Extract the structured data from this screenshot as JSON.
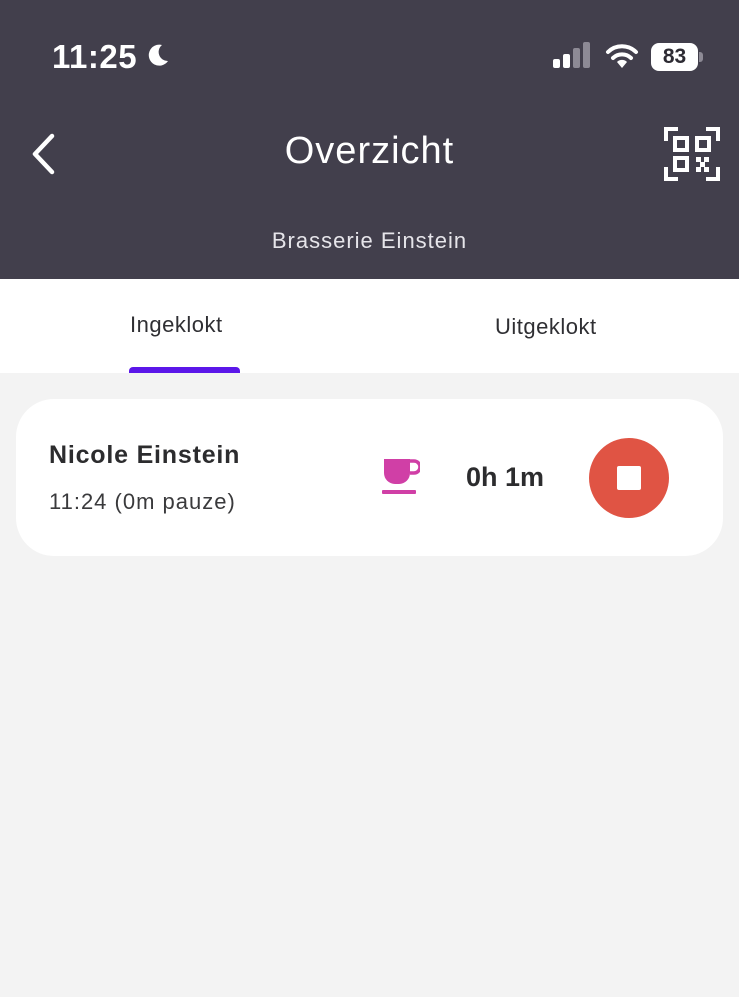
{
  "status_bar": {
    "time": "11:25",
    "battery": "83"
  },
  "header": {
    "title": "Overzicht",
    "subtitle": "Brasserie Einstein"
  },
  "tabs": [
    {
      "label": "Ingeklokt",
      "active": true
    },
    {
      "label": "Uitgeklokt",
      "active": false
    }
  ],
  "entries": [
    {
      "name": "Nicole Einstein",
      "clock_in": "11:24 (0m pauze)",
      "duration": "0h 1m",
      "break_icon": "coffee-cup-icon",
      "action_icon": "stop-icon"
    }
  ],
  "colors": {
    "header_bg": "#423f4c",
    "tab_indicator": "#5b17e9",
    "cup_icon": "#d03fa6",
    "stop_button": "#e05444",
    "page_bg": "#f3f3f3"
  }
}
